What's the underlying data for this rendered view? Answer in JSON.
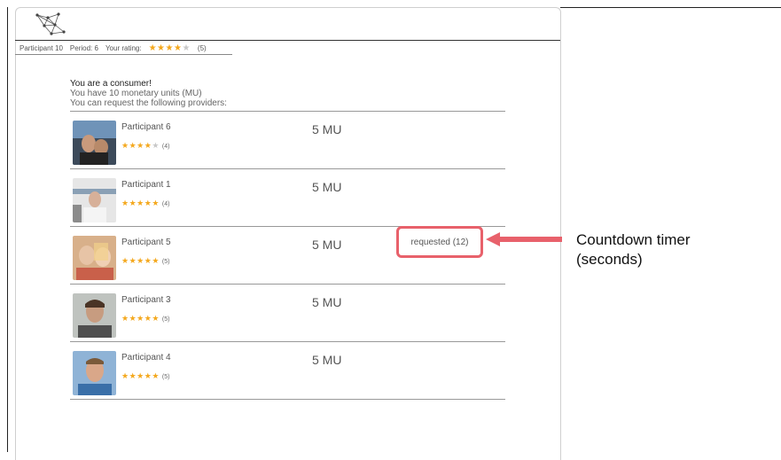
{
  "status": {
    "participant": "Participant 10",
    "period": "Period: 6",
    "rating_label": "Your rating:",
    "rating_value": 4,
    "rating_count": "(5)"
  },
  "intro": {
    "role": "You are a consumer!",
    "balance": "You have 10 monetary units (MU)",
    "instruction": "You can request the following providers:"
  },
  "providers": [
    {
      "name": "Participant 6",
      "rating": 4,
      "count": "(4)",
      "price": "5 MU"
    },
    {
      "name": "Participant 1",
      "rating": 4.5,
      "count": "(4)",
      "price": "5 MU"
    },
    {
      "name": "Participant 5",
      "rating": 5,
      "count": "(5)",
      "price": "5 MU",
      "request_status": "requested (12)"
    },
    {
      "name": "Participant 3",
      "rating": 5,
      "count": "(5)",
      "price": "5 MU"
    },
    {
      "name": "Participant 4",
      "rating": 5,
      "count": "(5)",
      "price": "5 MU"
    }
  ],
  "annotation": {
    "line1": "Countdown timer",
    "line2": "(seconds)"
  },
  "colors": {
    "star": "#f4a81d",
    "star_empty": "#c8c8c8",
    "highlight": "#e8616b"
  },
  "icons": {
    "logo": "network-graph-icon",
    "star": "star-icon",
    "arrow": "left-arrow-icon"
  }
}
